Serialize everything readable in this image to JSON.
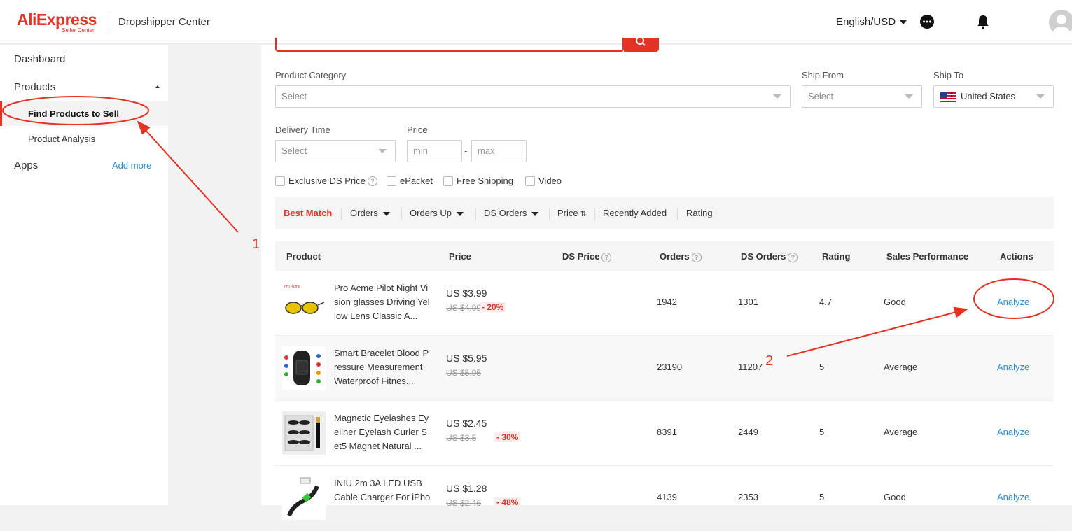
{
  "header": {
    "logo": "AliExpress",
    "logo_sub": "Seller Center",
    "title": "Dropshipper Center",
    "language": "English/USD"
  },
  "sidebar": {
    "dashboard": "Dashboard",
    "products": "Products",
    "find_products": "Find Products to Sell",
    "product_analysis": "Product Analysis",
    "apps": "Apps",
    "add_more": "Add more"
  },
  "filters": {
    "category_label": "Product Category",
    "category_placeholder": "Select",
    "ship_from_label": "Ship From",
    "ship_from_placeholder": "Select",
    "ship_to_label": "Ship To",
    "ship_to_value": "United States",
    "delivery_label": "Delivery Time",
    "delivery_placeholder": "Select",
    "price_label": "Price",
    "price_min": "min",
    "price_max": "max",
    "dash": "-",
    "checks": [
      "Exclusive DS Price",
      "ePacket",
      "Free Shipping",
      "Video"
    ]
  },
  "sort": [
    "Best Match",
    "Orders",
    "Orders Up",
    "DS Orders",
    "Price",
    "Recently Added",
    "Rating"
  ],
  "table": {
    "headers": [
      "Product",
      "Price",
      "DS Price",
      "Orders",
      "DS Orders",
      "Rating",
      "Sales Performance",
      "Actions"
    ],
    "rows": [
      {
        "name": "Pro Acme Pilot Night Vision glasses Driving Yellow Lens Classic A...",
        "price": "US $3.99",
        "old": "US $4.99",
        "disc": "- 20%",
        "orders": "1942",
        "ds_orders": "1301",
        "rating": "4.7",
        "perf": "Good",
        "action": "Analyze"
      },
      {
        "name": "Smart Bracelet Blood Pressure Measurement Waterproof Fitnes...",
        "price": "US $5.95",
        "old": "US $5.95",
        "disc": "",
        "orders": "23190",
        "ds_orders": "11207",
        "rating": "5",
        "perf": "Average",
        "action": "Analyze"
      },
      {
        "name": "Magnetic Eyelashes Eyeliner Eyelash Curler Set5 Magnet Natural ...",
        "price": "US $2.45",
        "old": "US $3.5",
        "disc": "- 30%",
        "orders": "8391",
        "ds_orders": "2449",
        "rating": "5",
        "perf": "Average",
        "action": "Analyze"
      },
      {
        "name": "INIU 2m 3A LED USB Cable Charger For iPho",
        "price": "US $1.28",
        "old": "US $2.46",
        "disc": "- 48%",
        "orders": "4139",
        "ds_orders": "2353",
        "rating": "5",
        "perf": "Good",
        "action": "Analyze"
      }
    ]
  },
  "annotations": {
    "one": "1",
    "two": "2"
  },
  "colors": {
    "brand": "#e43225",
    "link": "#2a8bd8"
  }
}
